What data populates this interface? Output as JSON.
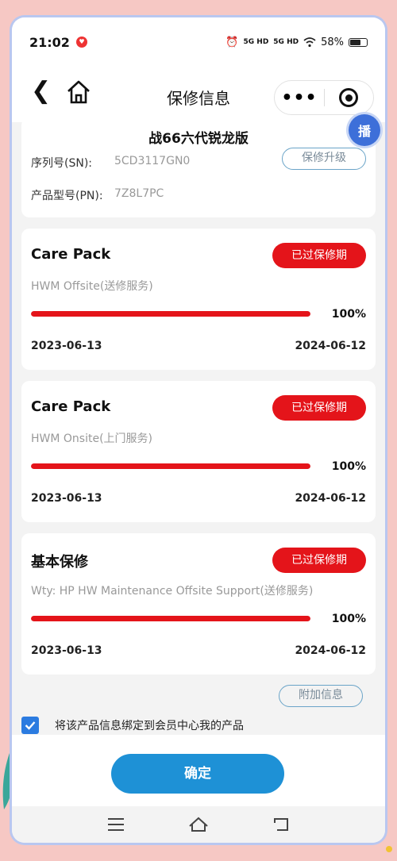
{
  "status_bar": {
    "time": "21:02",
    "network_1": "5G HD",
    "network_2": "5G HD",
    "battery": "58%"
  },
  "nav": {
    "title": "保修信息"
  },
  "product": {
    "name": "战66六代锐龙版",
    "sn_label": "序列号(SN):",
    "sn_value": "5CD3117GN0",
    "pn_label": "产品型号(PN):",
    "pn_value": "7Z8L7PC",
    "upgrade_label": "保修升级"
  },
  "chat_badge": "播",
  "warranties": [
    {
      "title": "Care Pack",
      "status": "已过保修期",
      "description": "HWM Offsite(送修服务)",
      "progress": 100,
      "progress_label": "100%",
      "start_date": "2023-06-13",
      "end_date": "2024-06-12"
    },
    {
      "title": "Care Pack",
      "status": "已过保修期",
      "description": "HWM Onsite(上门服务)",
      "progress": 100,
      "progress_label": "100%",
      "start_date": "2023-06-13",
      "end_date": "2024-06-12"
    },
    {
      "title": "基本保修",
      "status": "已过保修期",
      "description": "Wty: HP HW Maintenance Offsite Support(送修服务)",
      "progress": 100,
      "progress_label": "100%",
      "start_date": "2023-06-13",
      "end_date": "2024-06-12"
    }
  ],
  "extra_info_label": "附加信息",
  "bind": {
    "checked": true,
    "text": "将该产品信息绑定到会员中心我的产品"
  },
  "confirm_label": "确定",
  "colors": {
    "accent_red": "#e4141a",
    "confirm_blue": "#1e91d6",
    "checkbox_blue": "#2b7be0"
  }
}
